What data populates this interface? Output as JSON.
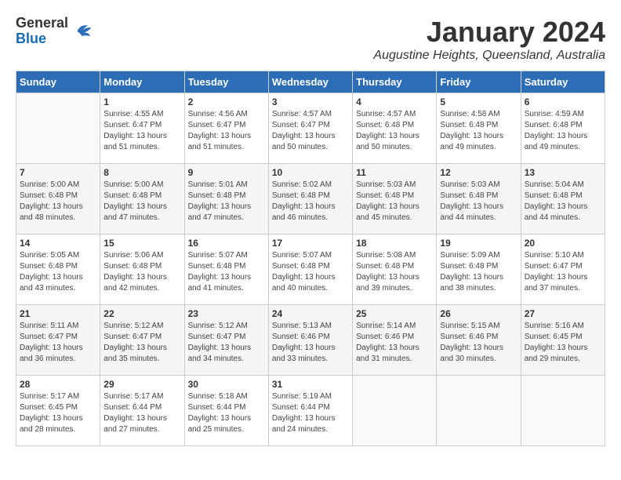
{
  "header": {
    "logo_general": "General",
    "logo_blue": "Blue",
    "month_title": "January 2024",
    "location": "Augustine Heights, Queensland, Australia"
  },
  "days_of_week": [
    "Sunday",
    "Monday",
    "Tuesday",
    "Wednesday",
    "Thursday",
    "Friday",
    "Saturday"
  ],
  "weeks": [
    [
      {
        "day": "",
        "sunrise": "",
        "sunset": "",
        "daylight": "",
        "empty": true
      },
      {
        "day": "1",
        "sunrise": "Sunrise: 4:55 AM",
        "sunset": "Sunset: 6:47 PM",
        "daylight": "Daylight: 13 hours and 51 minutes.",
        "empty": false
      },
      {
        "day": "2",
        "sunrise": "Sunrise: 4:56 AM",
        "sunset": "Sunset: 6:47 PM",
        "daylight": "Daylight: 13 hours and 51 minutes.",
        "empty": false
      },
      {
        "day": "3",
        "sunrise": "Sunrise: 4:57 AM",
        "sunset": "Sunset: 6:47 PM",
        "daylight": "Daylight: 13 hours and 50 minutes.",
        "empty": false
      },
      {
        "day": "4",
        "sunrise": "Sunrise: 4:57 AM",
        "sunset": "Sunset: 6:48 PM",
        "daylight": "Daylight: 13 hours and 50 minutes.",
        "empty": false
      },
      {
        "day": "5",
        "sunrise": "Sunrise: 4:58 AM",
        "sunset": "Sunset: 6:48 PM",
        "daylight": "Daylight: 13 hours and 49 minutes.",
        "empty": false
      },
      {
        "day": "6",
        "sunrise": "Sunrise: 4:59 AM",
        "sunset": "Sunset: 6:48 PM",
        "daylight": "Daylight: 13 hours and 49 minutes.",
        "empty": false
      }
    ],
    [
      {
        "day": "7",
        "sunrise": "Sunrise: 5:00 AM",
        "sunset": "Sunset: 6:48 PM",
        "daylight": "Daylight: 13 hours and 48 minutes.",
        "empty": false
      },
      {
        "day": "8",
        "sunrise": "Sunrise: 5:00 AM",
        "sunset": "Sunset: 6:48 PM",
        "daylight": "Daylight: 13 hours and 47 minutes.",
        "empty": false
      },
      {
        "day": "9",
        "sunrise": "Sunrise: 5:01 AM",
        "sunset": "Sunset: 6:48 PM",
        "daylight": "Daylight: 13 hours and 47 minutes.",
        "empty": false
      },
      {
        "day": "10",
        "sunrise": "Sunrise: 5:02 AM",
        "sunset": "Sunset: 6:48 PM",
        "daylight": "Daylight: 13 hours and 46 minutes.",
        "empty": false
      },
      {
        "day": "11",
        "sunrise": "Sunrise: 5:03 AM",
        "sunset": "Sunset: 6:48 PM",
        "daylight": "Daylight: 13 hours and 45 minutes.",
        "empty": false
      },
      {
        "day": "12",
        "sunrise": "Sunrise: 5:03 AM",
        "sunset": "Sunset: 6:48 PM",
        "daylight": "Daylight: 13 hours and 44 minutes.",
        "empty": false
      },
      {
        "day": "13",
        "sunrise": "Sunrise: 5:04 AM",
        "sunset": "Sunset: 6:48 PM",
        "daylight": "Daylight: 13 hours and 44 minutes.",
        "empty": false
      }
    ],
    [
      {
        "day": "14",
        "sunrise": "Sunrise: 5:05 AM",
        "sunset": "Sunset: 6:48 PM",
        "daylight": "Daylight: 13 hours and 43 minutes.",
        "empty": false
      },
      {
        "day": "15",
        "sunrise": "Sunrise: 5:06 AM",
        "sunset": "Sunset: 6:48 PM",
        "daylight": "Daylight: 13 hours and 42 minutes.",
        "empty": false
      },
      {
        "day": "16",
        "sunrise": "Sunrise: 5:07 AM",
        "sunset": "Sunset: 6:48 PM",
        "daylight": "Daylight: 13 hours and 41 minutes.",
        "empty": false
      },
      {
        "day": "17",
        "sunrise": "Sunrise: 5:07 AM",
        "sunset": "Sunset: 6:48 PM",
        "daylight": "Daylight: 13 hours and 40 minutes.",
        "empty": false
      },
      {
        "day": "18",
        "sunrise": "Sunrise: 5:08 AM",
        "sunset": "Sunset: 6:48 PM",
        "daylight": "Daylight: 13 hours and 39 minutes.",
        "empty": false
      },
      {
        "day": "19",
        "sunrise": "Sunrise: 5:09 AM",
        "sunset": "Sunset: 6:48 PM",
        "daylight": "Daylight: 13 hours and 38 minutes.",
        "empty": false
      },
      {
        "day": "20",
        "sunrise": "Sunrise: 5:10 AM",
        "sunset": "Sunset: 6:47 PM",
        "daylight": "Daylight: 13 hours and 37 minutes.",
        "empty": false
      }
    ],
    [
      {
        "day": "21",
        "sunrise": "Sunrise: 5:11 AM",
        "sunset": "Sunset: 6:47 PM",
        "daylight": "Daylight: 13 hours and 36 minutes.",
        "empty": false
      },
      {
        "day": "22",
        "sunrise": "Sunrise: 5:12 AM",
        "sunset": "Sunset: 6:47 PM",
        "daylight": "Daylight: 13 hours and 35 minutes.",
        "empty": false
      },
      {
        "day": "23",
        "sunrise": "Sunrise: 5:12 AM",
        "sunset": "Sunset: 6:47 PM",
        "daylight": "Daylight: 13 hours and 34 minutes.",
        "empty": false
      },
      {
        "day": "24",
        "sunrise": "Sunrise: 5:13 AM",
        "sunset": "Sunset: 6:46 PM",
        "daylight": "Daylight: 13 hours and 33 minutes.",
        "empty": false
      },
      {
        "day": "25",
        "sunrise": "Sunrise: 5:14 AM",
        "sunset": "Sunset: 6:46 PM",
        "daylight": "Daylight: 13 hours and 31 minutes.",
        "empty": false
      },
      {
        "day": "26",
        "sunrise": "Sunrise: 5:15 AM",
        "sunset": "Sunset: 6:46 PM",
        "daylight": "Daylight: 13 hours and 30 minutes.",
        "empty": false
      },
      {
        "day": "27",
        "sunrise": "Sunrise: 5:16 AM",
        "sunset": "Sunset: 6:45 PM",
        "daylight": "Daylight: 13 hours and 29 minutes.",
        "empty": false
      }
    ],
    [
      {
        "day": "28",
        "sunrise": "Sunrise: 5:17 AM",
        "sunset": "Sunset: 6:45 PM",
        "daylight": "Daylight: 13 hours and 28 minutes.",
        "empty": false
      },
      {
        "day": "29",
        "sunrise": "Sunrise: 5:17 AM",
        "sunset": "Sunset: 6:44 PM",
        "daylight": "Daylight: 13 hours and 27 minutes.",
        "empty": false
      },
      {
        "day": "30",
        "sunrise": "Sunrise: 5:18 AM",
        "sunset": "Sunset: 6:44 PM",
        "daylight": "Daylight: 13 hours and 25 minutes.",
        "empty": false
      },
      {
        "day": "31",
        "sunrise": "Sunrise: 5:19 AM",
        "sunset": "Sunset: 6:44 PM",
        "daylight": "Daylight: 13 hours and 24 minutes.",
        "empty": false
      },
      {
        "day": "",
        "sunrise": "",
        "sunset": "",
        "daylight": "",
        "empty": true
      },
      {
        "day": "",
        "sunrise": "",
        "sunset": "",
        "daylight": "",
        "empty": true
      },
      {
        "day": "",
        "sunrise": "",
        "sunset": "",
        "daylight": "",
        "empty": true
      }
    ]
  ]
}
